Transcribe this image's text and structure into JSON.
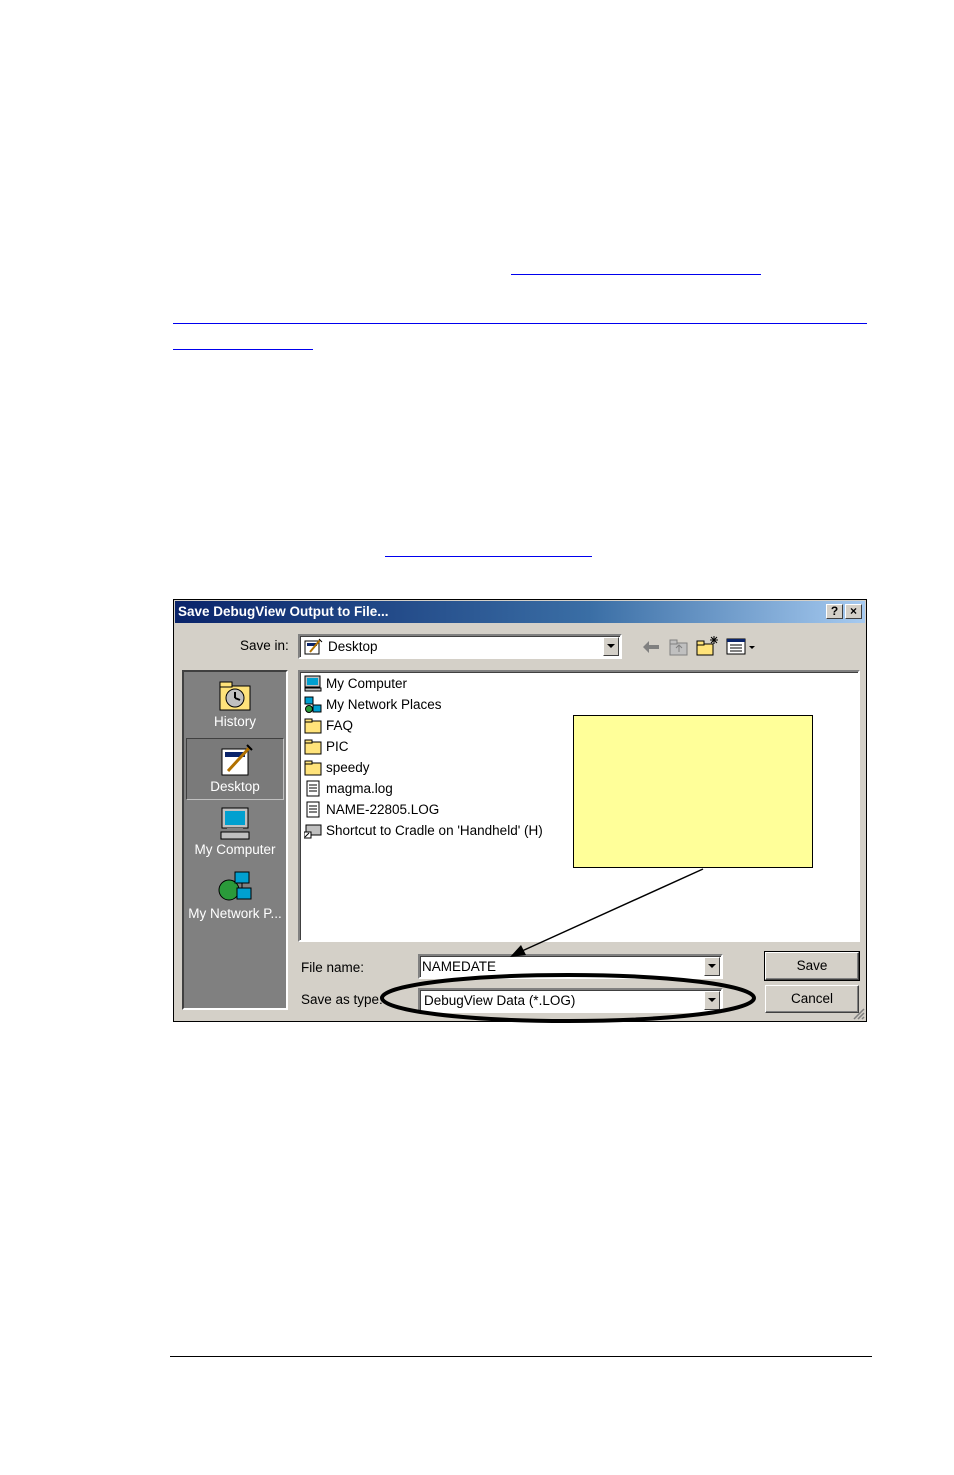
{
  "dialog": {
    "title": "Save DebugView Output to File...",
    "help_button": "?",
    "close_button": "×",
    "save_in_label": "Save in:",
    "save_in_value": "Desktop",
    "places": [
      {
        "label": "History",
        "icon": "history-icon"
      },
      {
        "label": "Desktop",
        "icon": "desktop-icon",
        "selected": true
      },
      {
        "label": "My Computer",
        "icon": "my-computer-icon"
      },
      {
        "label": "My Network P...",
        "icon": "my-network-places-icon"
      }
    ],
    "files": [
      {
        "name": "My Computer",
        "icon": "computer-icon"
      },
      {
        "name": "My Network Places",
        "icon": "network-icon"
      },
      {
        "name": "FAQ",
        "icon": "folder-icon"
      },
      {
        "name": "PIC",
        "icon": "folder-icon"
      },
      {
        "name": "speedy",
        "icon": "folder-icon"
      },
      {
        "name": "magma.log",
        "icon": "text-file-icon"
      },
      {
        "name": "NAME-22805.LOG",
        "icon": "text-file-icon"
      },
      {
        "name": "Shortcut to Cradle on 'Handheld' (H)",
        "icon": "shortcut-icon"
      }
    ],
    "file_name_label": "File name:",
    "file_name_value": "NAMEDATE",
    "save_as_type_label": "Save as type:",
    "save_as_type_value": "DebugView Data (*.LOG)",
    "save_button": "Save",
    "cancel_button": "Cancel"
  },
  "colors": {
    "titlebar_start": "#0a246a",
    "titlebar_end": "#a6caf0",
    "face": "#d4d0c8",
    "note_fill": "#ffff99",
    "link": "#0000ee"
  }
}
